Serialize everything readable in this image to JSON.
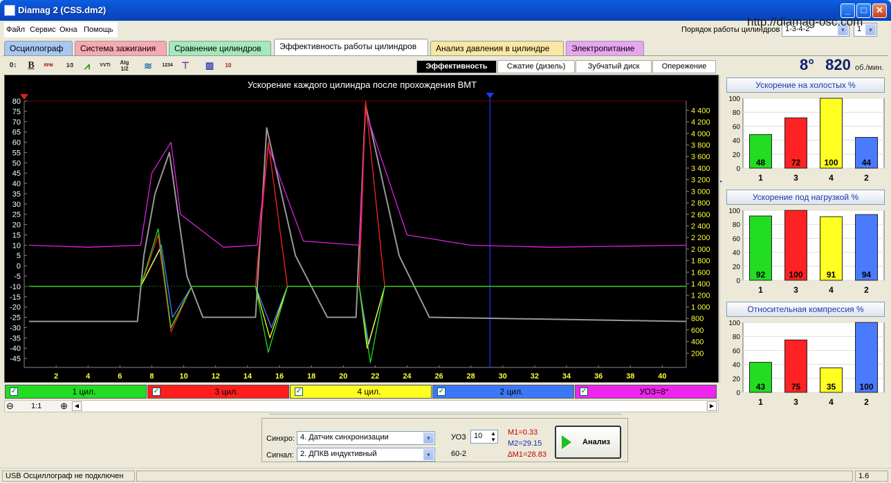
{
  "window": {
    "title": "Diamag 2 (CSS.dm2)",
    "minimize": "_",
    "maximize": "□",
    "close": "✕"
  },
  "menu": [
    "Файл",
    "Сервис",
    "Окна",
    "Помощь"
  ],
  "website": "http://diamag-osc.com",
  "firing_order": {
    "label": "Порядок работы цилиндров",
    "value": "1-3-4-2",
    "second_value": "1"
  },
  "tabs": [
    {
      "label": "Осциллограф",
      "color": "#a9c7f3"
    },
    {
      "label": "Система зажигания",
      "color": "#f7a9b2"
    },
    {
      "label": "Сравнение цилиндров",
      "color": "#a5e8b9"
    },
    {
      "label": "Эффективность работы цилиндров",
      "color": "#ffffff",
      "active": true
    },
    {
      "label": "Анализ давления в цилиндре",
      "color": "#f9e7a3"
    },
    {
      "label": "Электропитание",
      "color": "#e6a6f0"
    }
  ],
  "toolbar_icons": [
    "zoom-icon",
    "bold-icon",
    "rpm-icon",
    "numbering-icon",
    "curve-icon",
    "vvt-icon",
    "algorithm-icon",
    "filter-icon",
    "sequence-icon",
    "marker-icon",
    "cylinders-icon",
    "histogram-icon"
  ],
  "toolbar_text": {
    "rpm_badge": "RPM",
    "vvt": "VVTi",
    "alg": "Alg",
    "alg_sub": "1/2",
    "seq": "1234",
    "hist": "10"
  },
  "subtabs": [
    "Эффективность",
    "Сжатие (дизель)",
    "Зубчатый диск",
    "Опережение"
  ],
  "rpm_display": {
    "angle": "8°",
    "rpm": "820",
    "unit": "об./мин."
  },
  "main_chart": {
    "title": "Ускорение каждого цилиндра после прохождения ВМТ"
  },
  "chart_data": [
    {
      "type": "line",
      "title": "Ускорение каждого цилиндра после прохождения ВМТ",
      "x_ticks": [
        2,
        4,
        6,
        8,
        10,
        12,
        14,
        16,
        18,
        20,
        22,
        24,
        26,
        28,
        30,
        32,
        34,
        36,
        38,
        40
      ],
      "y_ticks": [
        80,
        75,
        70,
        65,
        60,
        55,
        50,
        45,
        40,
        35,
        30,
        25,
        20,
        15,
        10,
        5,
        0,
        -5,
        -10,
        -15,
        -20,
        -25,
        -30,
        -35,
        -40,
        -45
      ],
      "y2_ticks": [
        "4 400",
        "4 200",
        "4 000",
        "3 800",
        "3 600",
        "3 400",
        "3 200",
        "3 000",
        "2 800",
        "2 600",
        "2 400",
        "2 200",
        "2 000",
        "1 800",
        "1 600",
        "1 400",
        "1 200",
        "1 000",
        "800",
        "600",
        "400",
        "200"
      ],
      "xlim": [
        0,
        41.5
      ],
      "ylim": [
        -48,
        80
      ],
      "y2lim": [
        0,
        4560
      ],
      "series": [
        {
          "name": "1 цил.",
          "color": "#22dd22",
          "x": [
            0.3,
            7.3,
            8.4,
            9.2,
            10.5,
            14.5,
            15.3,
            16.5,
            21,
            21.7,
            22.6,
            41.5
          ],
          "y": [
            -10,
            -10,
            18,
            -30,
            -10,
            -10,
            -42,
            -10,
            -10,
            -47,
            -10,
            -10
          ]
        },
        {
          "name": "3 цил.",
          "color": "#ff2222",
          "x": [
            0.3,
            7.3,
            8.4,
            9.2,
            10.5,
            14.5,
            15.3,
            16.5,
            21,
            21.4,
            22.6,
            41.5
          ],
          "y": [
            -10,
            -10,
            15,
            -32,
            -10,
            -10,
            60,
            -10,
            -10,
            80,
            -10,
            -10
          ]
        },
        {
          "name": "4 цил.",
          "color": "#ffff22",
          "x": [
            0.3,
            7.3,
            8.5,
            9.2,
            10.5,
            14.5,
            15.4,
            16.5,
            21,
            21.5,
            22.6,
            41.5
          ],
          "y": [
            -10,
            -10,
            8,
            -30,
            -10,
            -10,
            -35,
            -10,
            -10,
            -40,
            -10,
            -10
          ]
        },
        {
          "name": "2 цил.",
          "color": "#4a7bff",
          "x": [
            0.3,
            7.3,
            8.6,
            9.3,
            10.5,
            14.5,
            15.5,
            16.5,
            21,
            21.6,
            22.6,
            41.5
          ],
          "y": [
            -10,
            -10,
            10,
            -25,
            -10,
            -10,
            -30,
            -10,
            -10,
            -38,
            -10,
            -10
          ]
        },
        {
          "name": "УОЗ=8°",
          "color": "#e020e0",
          "x": [
            0.3,
            4,
            7.3,
            8,
            9.2,
            9.8,
            12.5,
            14.6,
            15.3,
            17.5,
            21,
            21.4,
            24,
            28,
            33,
            41.5
          ],
          "y": [
            10,
            9,
            10,
            45,
            60,
            25,
            9,
            10,
            58,
            12,
            10,
            75,
            15,
            10,
            9,
            10
          ]
        },
        {
          "name": "RPM",
          "color": "#999999",
          "x": [
            0.3,
            7.1,
            7.5,
            8.2,
            9.1,
            10.2,
            11.2,
            14.5,
            15.2,
            17,
            19,
            20.8,
            21.4,
            23.5,
            25.4,
            41.5
          ],
          "y": [
            -27,
            -27,
            5,
            35,
            55,
            -5,
            -25,
            -25,
            67,
            5,
            -25,
            -25,
            78,
            5,
            -25,
            -27
          ]
        }
      ],
      "vline_x": 29.2
    },
    {
      "type": "bar",
      "title": "Ускорение на холостых %",
      "categories": [
        "1",
        "3",
        "4",
        "2"
      ],
      "values": [
        48,
        72,
        100,
        44
      ],
      "colors": [
        "#22dd22",
        "#ff2222",
        "#ffff22",
        "#4a7bff"
      ],
      "ylim": [
        0,
        100
      ],
      "y_ticks": [
        100,
        80,
        60,
        40,
        20,
        0
      ]
    },
    {
      "type": "bar",
      "title": "Ускорение под нагрузкой %",
      "categories": [
        "1",
        "3",
        "4",
        "2"
      ],
      "values": [
        92,
        100,
        91,
        94
      ],
      "colors": [
        "#22dd22",
        "#ff2222",
        "#ffff22",
        "#4a7bff"
      ],
      "ylim": [
        0,
        100
      ],
      "y_ticks": [
        100,
        80,
        60,
        40,
        20,
        0
      ]
    },
    {
      "type": "bar",
      "title": "Относительная компрессия %",
      "categories": [
        "1",
        "3",
        "4",
        "2"
      ],
      "values": [
        43,
        75,
        35,
        100
      ],
      "colors": [
        "#22dd22",
        "#ff2222",
        "#ffff22",
        "#4a7bff"
      ],
      "ylim": [
        0,
        100
      ],
      "y_ticks": [
        100,
        80,
        60,
        40,
        20,
        0
      ]
    }
  ],
  "legend": [
    {
      "label": "1 цил.",
      "color": "#22dd22"
    },
    {
      "label": "3 цил.",
      "color": "#ff1e1e"
    },
    {
      "label": "4 цил.",
      "color": "#ffff22"
    },
    {
      "label": "2 цил.",
      "color": "#3c78f5"
    },
    {
      "label": "УОЗ=8°",
      "color": "#ec26ec"
    }
  ],
  "zoom": {
    "value": "1:1",
    "minus": "⊖",
    "plus": "⊕"
  },
  "bottom_panel": {
    "sync_label": "Синхро:",
    "sync_value": "4.  Датчик синхронизации",
    "signal_label": "Сигнал:",
    "signal_value": "2.  ДПКВ индуктивный",
    "uoz_label": "УОЗ",
    "uoz_value": "10",
    "teeth": "60-2",
    "m1": "M1=0.33",
    "m2": "M2=29.15",
    "dm1": "∆M1=28.83",
    "analyze_label": "Анализ"
  },
  "status": {
    "left": "USB Осциллограф не подключен",
    "right": "1.6"
  }
}
